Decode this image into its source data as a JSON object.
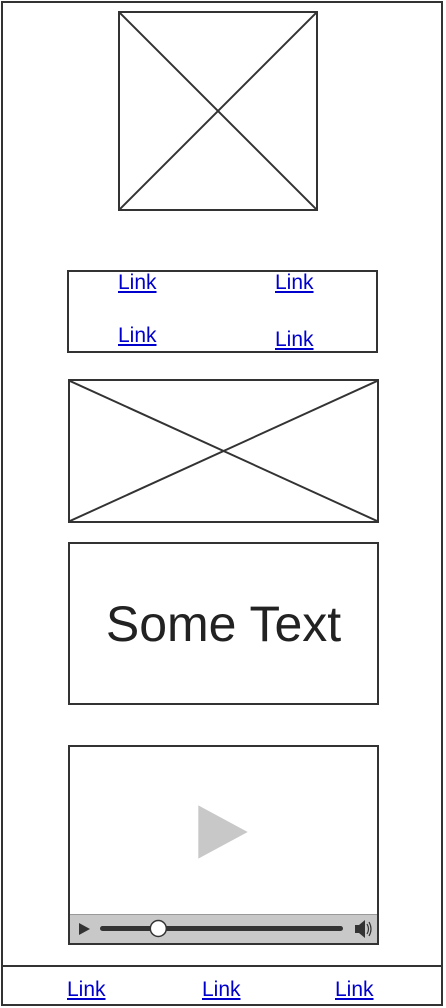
{
  "top_image": {
    "icon": "image-placeholder-icon"
  },
  "link_grid": {
    "links": [
      "Link",
      "Link",
      "Link",
      "Link"
    ]
  },
  "banner_image": {
    "icon": "image-placeholder-icon"
  },
  "text_block": {
    "text": "Some Text"
  },
  "video": {
    "play_icon": "play-icon",
    "volume_icon": "volume-icon",
    "progress": 0.24
  },
  "footer": {
    "links": [
      "Link",
      "Link",
      "Link"
    ]
  }
}
